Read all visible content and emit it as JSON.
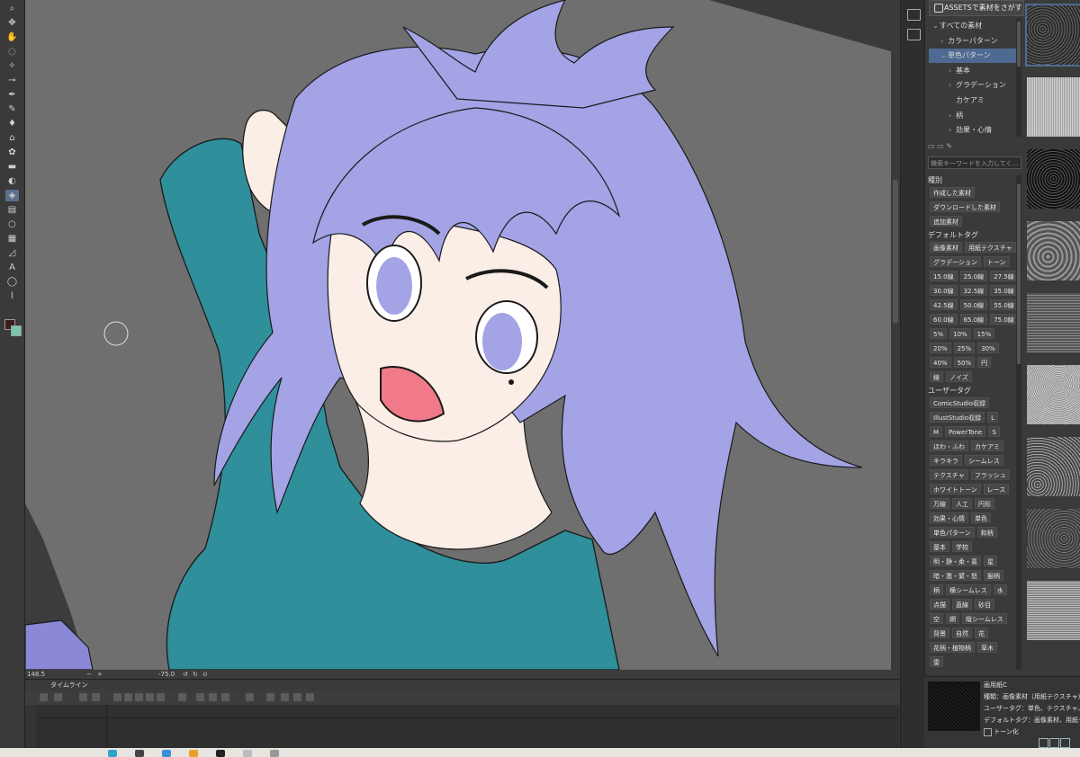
{
  "toolbar": {
    "tools": [
      "zoom-icon",
      "move-icon",
      "hand-icon",
      "lasso-icon",
      "wand-icon",
      "eyedropper-icon",
      "pen-icon",
      "pencil-icon",
      "brush-icon",
      "airbrush-icon",
      "decoration-icon",
      "eraser-icon",
      "blend-icon",
      "fill-icon",
      "gradient-icon",
      "ellipse-icon",
      "frame-icon",
      "ruler-icon",
      "text-icon",
      "balloon-icon",
      "correction-icon"
    ],
    "active_tool": "fill-icon",
    "main_color": "#3a1f1f",
    "sub_color": "#7bc7a7"
  },
  "canvas": {
    "background": "#6f6f6f"
  },
  "statusbar": {
    "zoom": "148.5",
    "angle": "-75.0"
  },
  "timeline": {
    "tab_label": "タイムライン"
  },
  "panel": {
    "assets_button": "ASSETSで素材をさがす",
    "tree": [
      {
        "label": "すべての素材",
        "arrow": "⌄",
        "indent": 0,
        "selected": false
      },
      {
        "label": "カラーパターン",
        "arrow": "›",
        "indent": 1,
        "selected": false
      },
      {
        "label": "単色パターン",
        "arrow": "⌄",
        "indent": 1,
        "selected": true
      },
      {
        "label": "基本",
        "arrow": "›",
        "indent": 2,
        "selected": false
      },
      {
        "label": "グラデーション",
        "arrow": "›",
        "indent": 2,
        "selected": false
      },
      {
        "label": "カケアミ",
        "arrow": "",
        "indent": 2,
        "selected": false
      },
      {
        "label": "柄",
        "arrow": "›",
        "indent": 2,
        "selected": false
      },
      {
        "label": "効果・心情",
        "arrow": "›",
        "indent": 2,
        "selected": false
      }
    ],
    "search_placeholder": "検索キーワードを入力してく...",
    "section_kind": "種別",
    "kind_tags": [
      "作成した素材",
      "ダウンロードした素材",
      "追加素材"
    ],
    "section_default": "デフォルトタグ",
    "default_tags": [
      [
        "画像素材",
        "用紙テクスチャ"
      ],
      [
        "グラデーション",
        "トーン"
      ],
      [
        "15.0線",
        "25.0線",
        "27.5線"
      ],
      [
        "30.0線",
        "32.5線",
        "35.0線"
      ],
      [
        "42.5線",
        "50.0線",
        "55.0線"
      ],
      [
        "60.0線",
        "65.0線",
        "75.0線"
      ],
      [
        "5%",
        "10%",
        "15%"
      ],
      [
        "20%",
        "25%",
        "30%"
      ],
      [
        "40%",
        "50%",
        "円"
      ],
      [
        "線",
        "ノイズ"
      ]
    ],
    "section_user": "ユーザータグ",
    "user_tags": [
      [
        "ComicStudio収録"
      ],
      [
        "IllustStudio収録",
        "L"
      ],
      [
        "M",
        "PowerTone",
        "S"
      ],
      [
        "ほわ・ふわ",
        "カケアミ"
      ],
      [
        "キラキラ",
        "シームレス"
      ],
      [
        "テクスチャ",
        "フラッシュ"
      ],
      [
        "ホワイトトーン",
        "レース"
      ],
      [
        "万線",
        "人工",
        "円形"
      ],
      [
        "効果・心情",
        "単色"
      ],
      [
        "単色パターン",
        "和柄"
      ],
      [
        "基本",
        "学校"
      ],
      [
        "明・静・柔・喜",
        "星"
      ],
      [
        "暗・激・緊・怒",
        "服柄"
      ],
      [
        "柄",
        "横シームレス",
        "水"
      ],
      [
        "点描",
        "直線",
        "砂目"
      ],
      [
        "空",
        "網",
        "縦シームレス"
      ],
      [
        "背景",
        "自然",
        "花"
      ],
      [
        "花柄・植物柄",
        "草木"
      ],
      [
        "雷"
      ]
    ]
  },
  "info": {
    "name": "画用紙C",
    "kind": "種類：画像素材（用紙テクスチャ）",
    "user_tag": "ユーザータグ：単色、テクスチャ、単色パ",
    "default_tag": "デフォルトタグ：画像素材、用紙テクス",
    "tone_label": "トーン化"
  },
  "colors": {
    "hair": "#a3a3e6",
    "skin": "#fbeee6",
    "shirt": "#2f8f9b",
    "mouth": "#f07a88",
    "selection": "#4f6a92"
  }
}
